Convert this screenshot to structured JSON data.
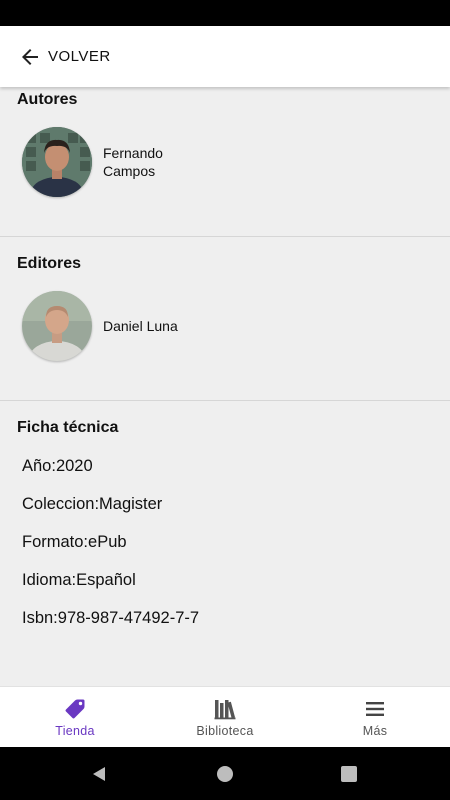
{
  "top_bar": {
    "back_label": "VOLVER"
  },
  "autores": {
    "title": "Autores",
    "people": [
      {
        "name": "Fernando Campos"
      }
    ]
  },
  "editores": {
    "title": "Editores",
    "people": [
      {
        "name": "Daniel Luna"
      }
    ]
  },
  "ficha": {
    "title": "Ficha técnica",
    "lines": [
      "Año:2020",
      "Coleccion:Magister",
      "Formato:ePub",
      "Idioma:Español",
      "Isbn:978-987-47492-7-7"
    ]
  },
  "bottom_nav": {
    "items": [
      {
        "label": "Tienda",
        "icon": "tag-icon",
        "active": true
      },
      {
        "label": "Biblioteca",
        "icon": "library-icon",
        "active": false
      },
      {
        "label": "Más",
        "icon": "menu-icon",
        "active": false
      }
    ]
  },
  "colors": {
    "accent": "#6a38c2",
    "background": "#efefef"
  }
}
